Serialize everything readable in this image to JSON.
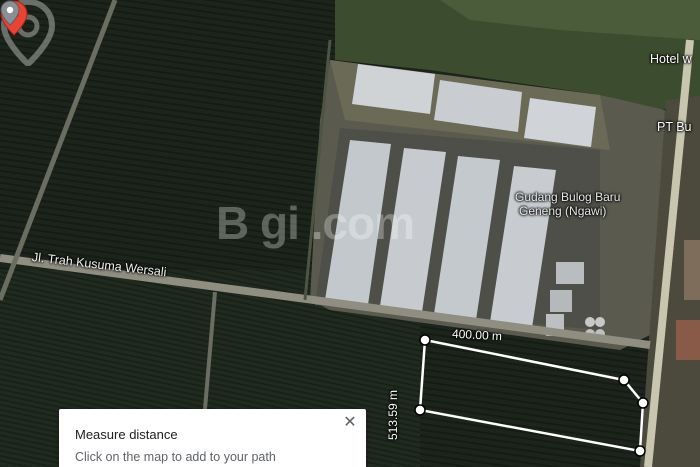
{
  "map": {
    "labels": {
      "road": "Jl. Trah Kusuma Wersali",
      "hotel": "Hotel w",
      "pt": "PT Bu",
      "gudang_line1": "Gudang Bulog Baru",
      "gudang_line2": "Geneng (Ngawi)"
    },
    "watermark": "B    gi   .com",
    "measurement": {
      "horizontal": "400.00 m",
      "vertical": "513.59 m"
    },
    "icons": {
      "red_pin": "location-pin-icon",
      "poi_pin": "poi-pin-icon",
      "close": "close-icon"
    }
  },
  "measure_panel": {
    "title": "Measure distance",
    "hint": "Click on the map to add to your path",
    "close": "✕"
  },
  "colors": {
    "field": "#1a2218",
    "warehouse_roof": "#c9cdd2",
    "red_pin": "#ea4335",
    "measure_line": "#ffffff"
  }
}
